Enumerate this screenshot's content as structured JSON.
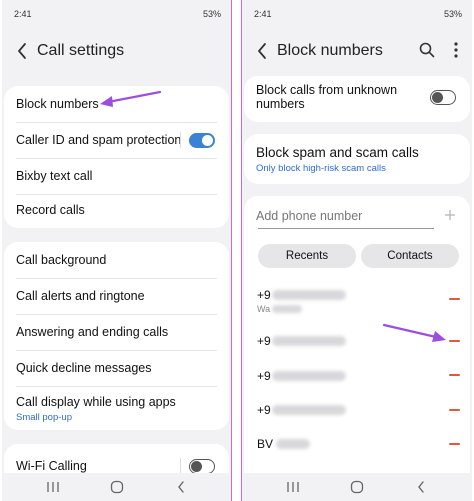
{
  "left": {
    "status": {
      "time": "2:41",
      "battery": "53%"
    },
    "title": "Call settings",
    "group1": [
      {
        "label": "Block numbers"
      },
      {
        "label": "Caller ID and spam protection",
        "toggle": "on"
      },
      {
        "label": "Bixby text call"
      },
      {
        "label": "Record calls"
      }
    ],
    "group2": [
      {
        "label": "Call background"
      },
      {
        "label": "Call alerts and ringtone"
      },
      {
        "label": "Answering and ending calls"
      },
      {
        "label": "Quick decline messages"
      },
      {
        "label": "Call display while using apps",
        "sub": "Small pop-up"
      }
    ],
    "group3": [
      {
        "label": "Wi-Fi Calling",
        "toggle": "off"
      }
    ]
  },
  "right": {
    "status": {
      "time": "2:41",
      "battery": "53%"
    },
    "title": "Block numbers",
    "unknown_label": "Block calls from unknown numbers",
    "unknown_toggle": "off",
    "spam_title": "Block spam and scam calls",
    "spam_sub": "Only block high-risk scam calls",
    "input_placeholder": "Add phone number",
    "recents_label": "Recents",
    "contacts_label": "Contacts",
    "blocked": [
      {
        "prefix": "+9",
        "sub": "Wa"
      },
      {
        "prefix": "+9"
      },
      {
        "prefix": "+9"
      },
      {
        "prefix": "+9"
      },
      {
        "prefix": "BV"
      }
    ]
  },
  "colors": {
    "accent": "#3b82d6",
    "remove": "#e05a3a",
    "annotation": "#9b4ee0"
  },
  "icons": [
    "back-icon",
    "search-icon",
    "more-options-icon",
    "add-icon",
    "remove-icon",
    "recent-apps-icon",
    "home-icon",
    "back-nav-icon"
  ]
}
